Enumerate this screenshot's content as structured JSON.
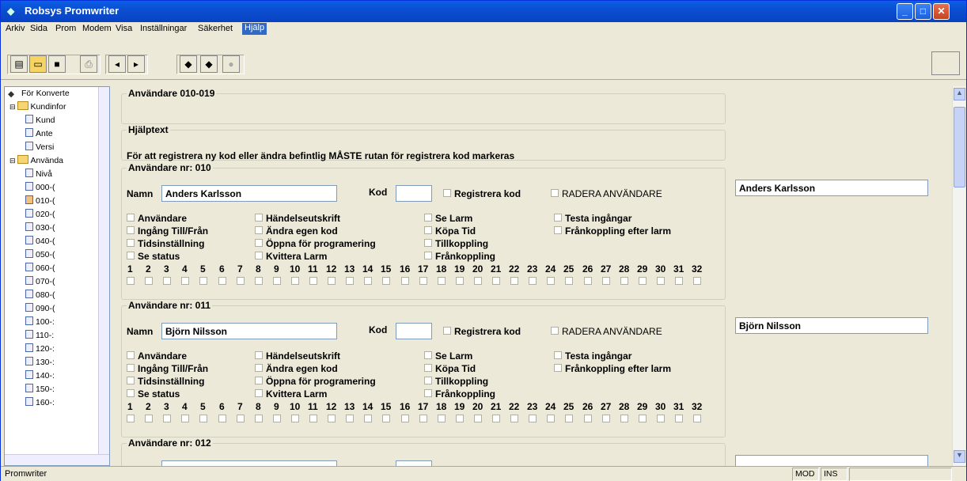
{
  "app": {
    "title": "Robsys Promwriter"
  },
  "menu": [
    "Arkiv",
    "Sida",
    "Prom",
    "Modem",
    "Visa",
    "Inställningar",
    "Säkerhet",
    "Hjälp"
  ],
  "tree": {
    "items": [
      "För Konverte",
      "Kundinfor",
      "Kund",
      "Ante",
      "Versi",
      "Använda",
      "Nivå",
      "000-(",
      "010-(",
      "020-(",
      "030-(",
      "040-(",
      "050-(",
      "060-(",
      "070-(",
      "080-(",
      "090-(",
      "100-:",
      "110-:",
      "120-:",
      "130-:",
      "140-:",
      "150-:",
      "160-:"
    ]
  },
  "main": {
    "group_title": "Användare 010-019",
    "help_title": "Hjälptext",
    "help_text": "För att registrera ny kod eller ändra befintlig MÅSTE rutan för registrera kod markeras",
    "labels": {
      "namn": "Namn",
      "kod": "Kod",
      "register_code": "Registrera kod",
      "delete_user": "RADERA ANVÄNDARE"
    },
    "permissions": [
      [
        "Användare",
        "Ingång Till/Från",
        "Tidsinställning",
        "Se status"
      ],
      [
        "Händelseutskrift",
        "Ändra egen kod",
        "Öppna för programering",
        "Kvittera Larm"
      ],
      [
        "Se Larm",
        "Köpa Tid",
        "Tillkoppling",
        "Frånkoppling"
      ],
      [
        "Testa ingångar",
        "Frånkoppling efter larm"
      ]
    ],
    "numbers": [
      "1",
      "2",
      "3",
      "4",
      "5",
      "6",
      "7",
      "8",
      "9",
      "10",
      "11",
      "12",
      "13",
      "14",
      "15",
      "16",
      "17",
      "18",
      "19",
      "20",
      "21",
      "22",
      "23",
      "24",
      "25",
      "26",
      "27",
      "28",
      "29",
      "30",
      "31",
      "32"
    ],
    "users": [
      {
        "title": "Användare nr: 010",
        "name": "Anders Karlsson",
        "name_side": "Anders Karlsson"
      },
      {
        "title": "Användare nr: 011",
        "name": "Björn Nilsson",
        "name_side": "Björn Nilsson"
      },
      {
        "title": "Användare nr: 012",
        "name": "",
        "name_side": ""
      }
    ]
  },
  "status": {
    "text": "Promwriter",
    "mod": "MOD",
    "ins": "INS"
  }
}
